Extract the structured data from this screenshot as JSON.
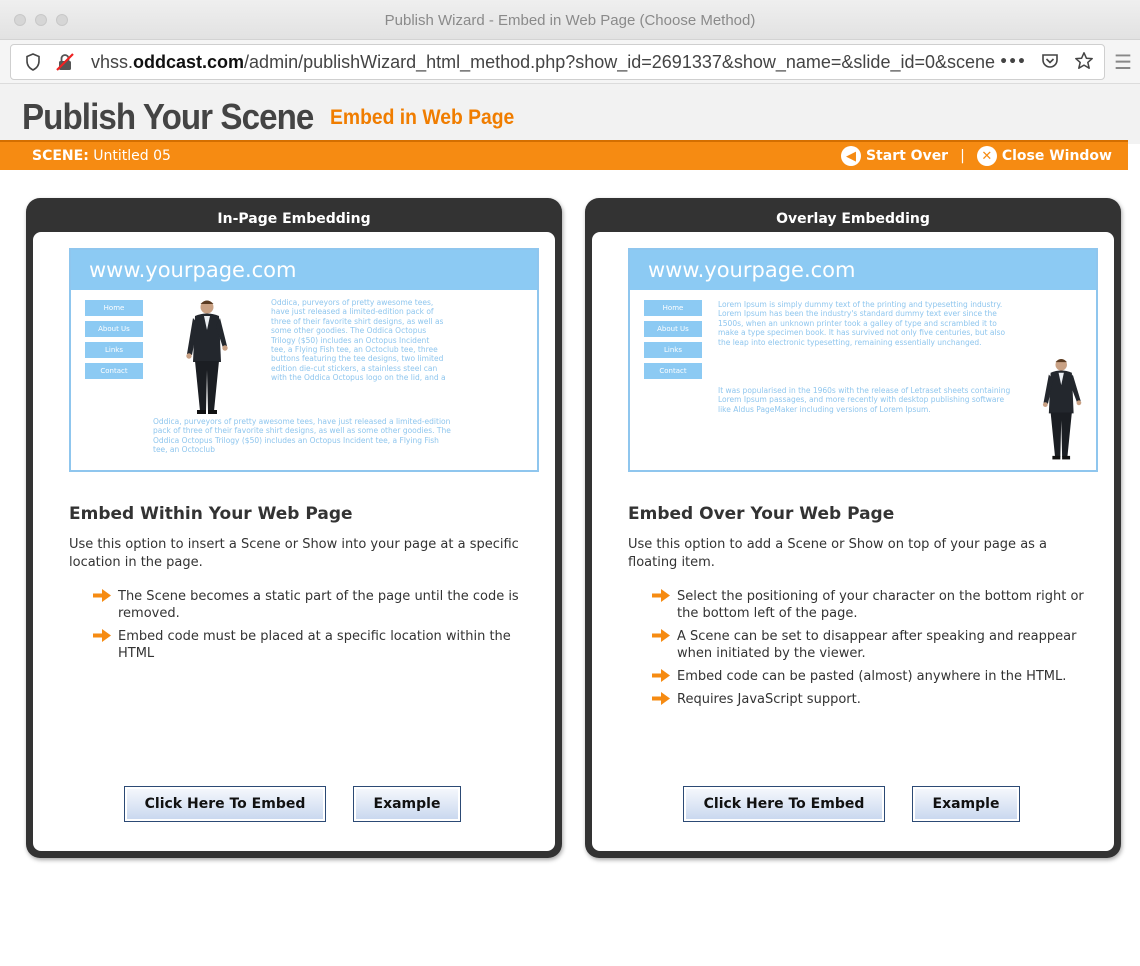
{
  "browser": {
    "window_title": "Publish Wizard - Embed in Web Page (Choose Method)",
    "url_domain": "vhss.",
    "url_host": "oddcast.com",
    "url_path": "/admin/publishWizard_html_method.php?show_id=2691337&show_name=&slide_id=0&scene",
    "url_ellipsis": "•••"
  },
  "header": {
    "title": "Publish Your Scene",
    "subtitle": "Embed in Web Page",
    "scene_label": "SCENE:",
    "scene_name": "Untitled 05",
    "start_over": "Start Over",
    "separator": "|",
    "close_window": "Close Window"
  },
  "panels": [
    {
      "heading": "In-Page Embedding",
      "preview_site": "www.yourpage.com",
      "preview_nav": [
        "Home",
        "About Us",
        "Links",
        "Contact"
      ],
      "preview_text_top": "Oddica, purveyors of pretty awesome tees, have just released a limited-edition pack of three of their favorite shirt designs, as well as some other goodies. The Oddica Octopus Trilogy ($50) includes an Octopus Incident tee, a Flying Fish tee, an Octoclub tee, three buttons featuring the tee designs, two limited edition die-cut stickers, a stainless steel can with the Oddica Octopus logo on the lid, and a",
      "preview_text_bottom": "Oddica, purveyors of pretty awesome tees, have just released a limited-edition pack of three of their favorite shirt designs, as well as some other goodies. The Oddica Octopus Trilogy ($50) includes an Octopus Incident tee, a Flying Fish tee, an Octoclub",
      "title": "Embed Within Your Web Page",
      "description": "Use this option to insert a Scene or Show into your page at a specific location in the page.",
      "bullets": [
        "The Scene becomes a static part of the page until the code is removed.",
        "Embed code must be placed at a specific location within the HTML"
      ],
      "embed_button": "Click Here To Embed",
      "example_button": "Example"
    },
    {
      "heading": "Overlay Embedding",
      "preview_site": "www.yourpage.com",
      "preview_nav": [
        "Home",
        "About Us",
        "Links",
        "Contact"
      ],
      "preview_text_top": "Lorem Ipsum is simply dummy text of the printing and typesetting industry. Lorem Ipsum has been the industry's standard dummy text ever since the 1500s, when an unknown printer took a galley of type and scrambled it to make a type specimen book. It has survived not only five centuries, but also the leap into electronic typesetting, remaining essentially unchanged.",
      "preview_text_bottom": "It was popularised in the 1960s with the release of Letraset sheets containing Lorem Ipsum passages, and more recently with desktop publishing software like Aldus PageMaker including versions of Lorem Ipsum.",
      "title": "Embed Over Your Web Page",
      "description": "Use this option to add a Scene or Show on top of your page as a floating item.",
      "bullets": [
        "Select the positioning of your character on the bottom right or the bottom left of the page.",
        "A Scene can be set to disappear after speaking and reappear when initiated by the viewer.",
        "Embed code can be pasted (almost) anywhere in the HTML.",
        "Requires JavaScript support."
      ],
      "embed_button": "Click Here To Embed",
      "example_button": "Example"
    }
  ],
  "colors": {
    "accent": "#f68b12",
    "title_orange": "#f07d00",
    "preview_blue": "#8ccaf3"
  }
}
